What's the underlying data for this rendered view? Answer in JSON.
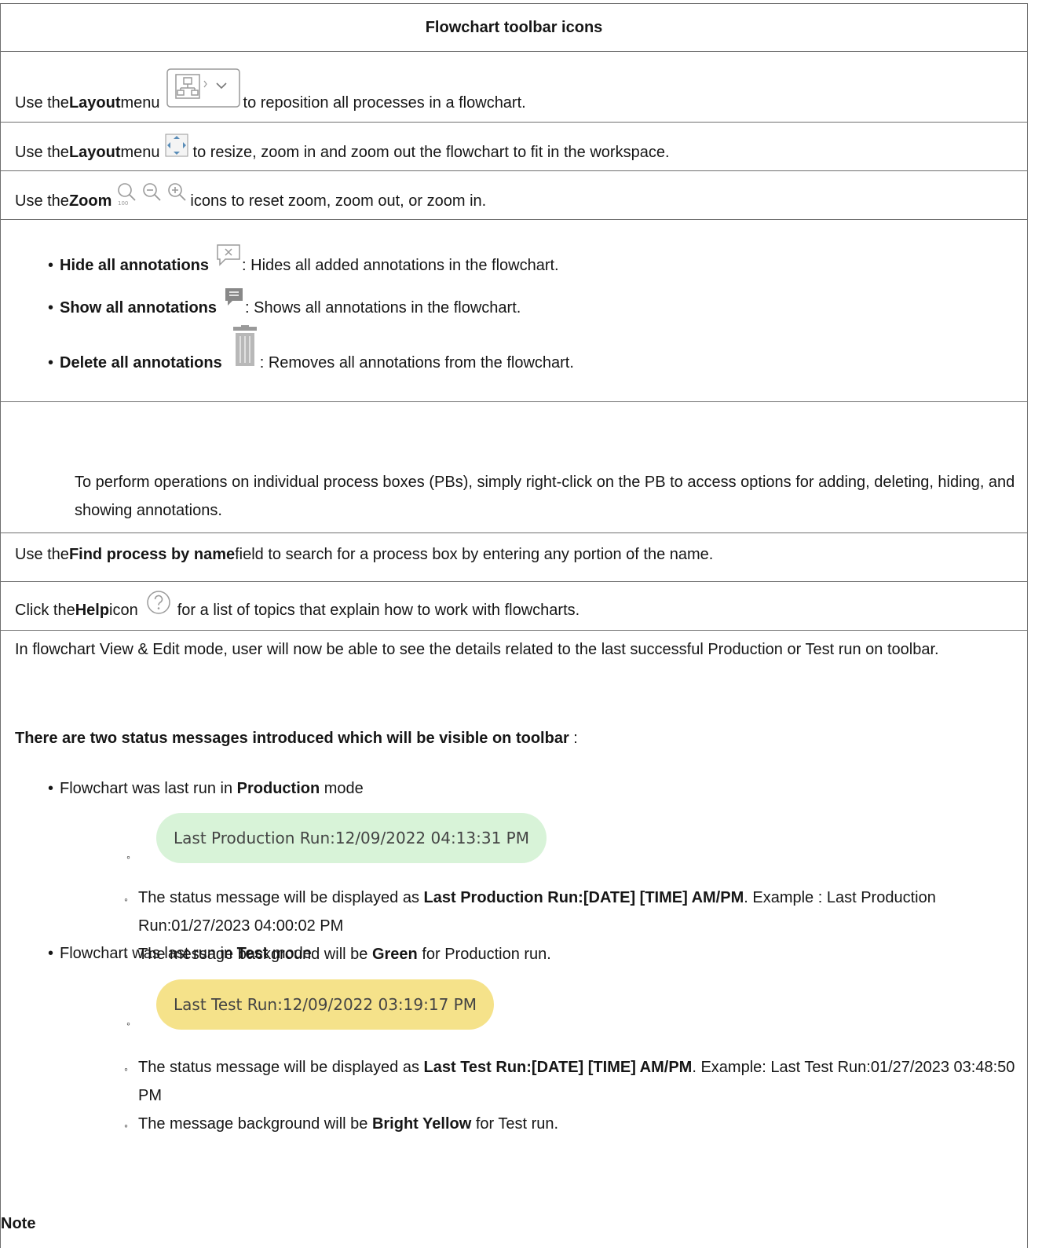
{
  "table": {
    "header": "Flowchart toolbar icons",
    "row_layout1": {
      "pre": "Use the ",
      "bold": "Layout",
      "mid": " menu",
      "post": " to reposition all processes in a flowchart."
    },
    "row_layout2": {
      "pre": "Use the ",
      "bold": "Layout",
      "mid": " menu",
      "post": " to resize, zoom in and zoom out the flowchart to fit in the workspace."
    },
    "row_zoom": {
      "pre": "Use the ",
      "bold": "Zoom",
      "post": " icons to reset zoom, zoom out, or zoom in."
    },
    "annotations": [
      {
        "bold": "Hide all annotations",
        "text": ": Hides all added annotations in the flowchart."
      },
      {
        "bold": "Show all annotations",
        "text": ": Shows all annotations in the flowchart."
      },
      {
        "bold": "Delete all annotations",
        "text": ": Removes all annotations from the flowchart."
      }
    ],
    "annotations_para": "To perform operations on individual process boxes (PBs), simply right-click on the PB to access options for adding, deleting, hiding, and showing annotations.",
    "row_find": {
      "pre": "Use the ",
      "bold": "Find process by name",
      "post": " field to search for a process box by entering any portion of the name."
    },
    "row_help": {
      "pre": "Click the ",
      "bold": "Help",
      "mid": " icon",
      "post": " for a list of topics that explain how to work with flowcharts."
    },
    "status": {
      "intro": "In flowchart View & Edit mode, user will now be able to see the details related to the last successful Production or Test run on toolbar.",
      "lead_bold": "There are two status messages introduced which will be visible on toolbar",
      "lead_tail": " :",
      "production": {
        "pre": "Flowchart was last run in ",
        "bold": "Production",
        "post": " mode",
        "pill": "Last Production Run:12/09/2022 04:13:31 PM",
        "sub1_pre": "The status message will be displayed as ",
        "sub1_bold": "Last Production Run:[DATE] [TIME] AM/PM",
        "sub1_post": ". Example : Last Production Run:01/27/2023 04:00:02 PM",
        "sub2_pre": "The message background will be ",
        "sub2_bold": "Green",
        "sub2_post": " for Production run."
      },
      "test": {
        "pre": "Flowchart was last run in ",
        "bold": "Test",
        "post": " mode",
        "pill": "Last Test Run:12/09/2022 03:19:17 PM",
        "sub1_pre": "The status message will be displayed as ",
        "sub1_bold": "Last Test Run:[DATE] [TIME] AM/PM",
        "sub1_post": ". Example: Last Test Run:01/27/2023 03:48:50 PM",
        "sub2_pre": "The message background will be ",
        "sub2_bold": "Bright Yellow",
        "sub2_post": " for Test run."
      },
      "note": "Note"
    }
  },
  "colors": {
    "border": "#6f6f6f",
    "production_pill": "#d8f3d8",
    "test_pill": "#f5e28a",
    "icon_gray": "#9a9a9a"
  },
  "icons": [
    "layout-menu-icon",
    "fit-to-screen-icon",
    "zoom-reset-icon",
    "zoom-out-icon",
    "zoom-in-icon",
    "hide-annotations-icon",
    "show-annotations-icon",
    "delete-annotations-icon",
    "help-icon"
  ]
}
